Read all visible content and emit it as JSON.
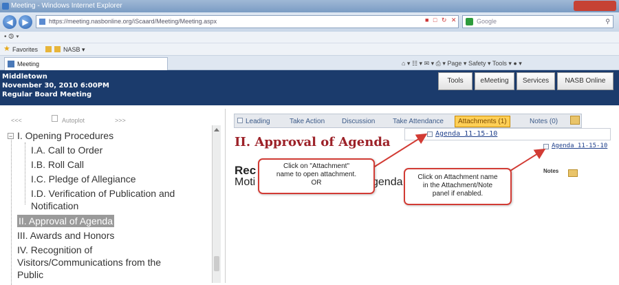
{
  "browser": {
    "title": "Meeting - Windows Internet Explorer",
    "url": "https://meeting.nasbonline.org/iScaard/Meeting/Meeting.aspx",
    "search_placeholder": "Google",
    "menu_text": "• ⧁ ▾",
    "favorites_label": "Favorites",
    "favorites_link": "NASB ▾",
    "page_tab": "Meeting",
    "command_bar": "Page ▾   Safety ▾   Tools ▾   ● ▾"
  },
  "header": {
    "org": "Middletown",
    "date": "November 30, 2010 6:00PM",
    "meeting_type": "Regular Board Meeting",
    "buttons": [
      "Tools",
      "eMeeting",
      "Services",
      "NASB Online"
    ]
  },
  "left": {
    "nav_prev": "<<<",
    "autoplot": "Autoplot",
    "nav_next": ">>>",
    "tree": [
      "I. Opening Procedures",
      "I.A. Call to Order",
      "I.B. Roll Call",
      "I.C. Pledge of Allegiance",
      "I.D. Verification of Publication and",
      "Notification",
      "II. Approval of Agenda",
      "III. Awards and Honors",
      "IV. Recognition of",
      "Visitors/Communications from the",
      "Public"
    ]
  },
  "right": {
    "tabs": [
      "Leading",
      "Take Action",
      "Discussion",
      "Take Attendance",
      "Attachments (1)",
      "Notes (0)"
    ],
    "attachment_name": "Agenda 11-15-10",
    "panel_attachment": "Agenda 11-15-10",
    "title": "II. Approval of Agenda",
    "rec_prefix": "Rec",
    "motion_prefix": "Moti",
    "motion_suffix": "genda",
    "notes_label": "Notes"
  },
  "callouts": {
    "left": [
      "Click on \"Attachment\"",
      "name to open attachment.",
      "OR"
    ],
    "right": [
      "Click on Attachment name",
      "in the Attachment/Note",
      "panel if enabled."
    ]
  },
  "colors": {
    "header_bg": "#1b3b6c",
    "title_red": "#9c2128",
    "callout_border": "#d23b34",
    "active_tab": "#ffcf56"
  }
}
